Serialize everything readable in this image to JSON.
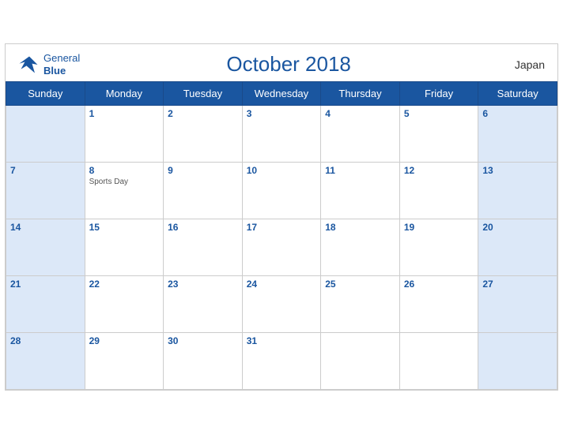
{
  "header": {
    "logo_line1": "General",
    "logo_line2": "Blue",
    "title": "October 2018",
    "country": "Japan"
  },
  "days_of_week": [
    "Sunday",
    "Monday",
    "Tuesday",
    "Wednesday",
    "Thursday",
    "Friday",
    "Saturday"
  ],
  "weeks": [
    [
      {
        "day": "",
        "empty": true,
        "class": "sunday"
      },
      {
        "day": "1",
        "class": "weekday"
      },
      {
        "day": "2",
        "class": "weekday"
      },
      {
        "day": "3",
        "class": "weekday"
      },
      {
        "day": "4",
        "class": "weekday"
      },
      {
        "day": "5",
        "class": "weekday"
      },
      {
        "day": "6",
        "class": "saturday"
      }
    ],
    [
      {
        "day": "7",
        "class": "sunday"
      },
      {
        "day": "8",
        "holiday": "Sports Day",
        "class": "weekday"
      },
      {
        "day": "9",
        "class": "weekday"
      },
      {
        "day": "10",
        "class": "weekday"
      },
      {
        "day": "11",
        "class": "weekday"
      },
      {
        "day": "12",
        "class": "weekday"
      },
      {
        "day": "13",
        "class": "saturday"
      }
    ],
    [
      {
        "day": "14",
        "class": "sunday"
      },
      {
        "day": "15",
        "class": "weekday"
      },
      {
        "day": "16",
        "class": "weekday"
      },
      {
        "day": "17",
        "class": "weekday"
      },
      {
        "day": "18",
        "class": "weekday"
      },
      {
        "day": "19",
        "class": "weekday"
      },
      {
        "day": "20",
        "class": "saturday"
      }
    ],
    [
      {
        "day": "21",
        "class": "sunday"
      },
      {
        "day": "22",
        "class": "weekday"
      },
      {
        "day": "23",
        "class": "weekday"
      },
      {
        "day": "24",
        "class": "weekday"
      },
      {
        "day": "25",
        "class": "weekday"
      },
      {
        "day": "26",
        "class": "weekday"
      },
      {
        "day": "27",
        "class": "saturday"
      }
    ],
    [
      {
        "day": "28",
        "class": "sunday"
      },
      {
        "day": "29",
        "class": "weekday"
      },
      {
        "day": "30",
        "class": "weekday"
      },
      {
        "day": "31",
        "class": "weekday"
      },
      {
        "day": "",
        "empty": true,
        "class": "weekday"
      },
      {
        "day": "",
        "empty": true,
        "class": "weekday"
      },
      {
        "day": "",
        "empty": true,
        "class": "saturday"
      }
    ]
  ]
}
